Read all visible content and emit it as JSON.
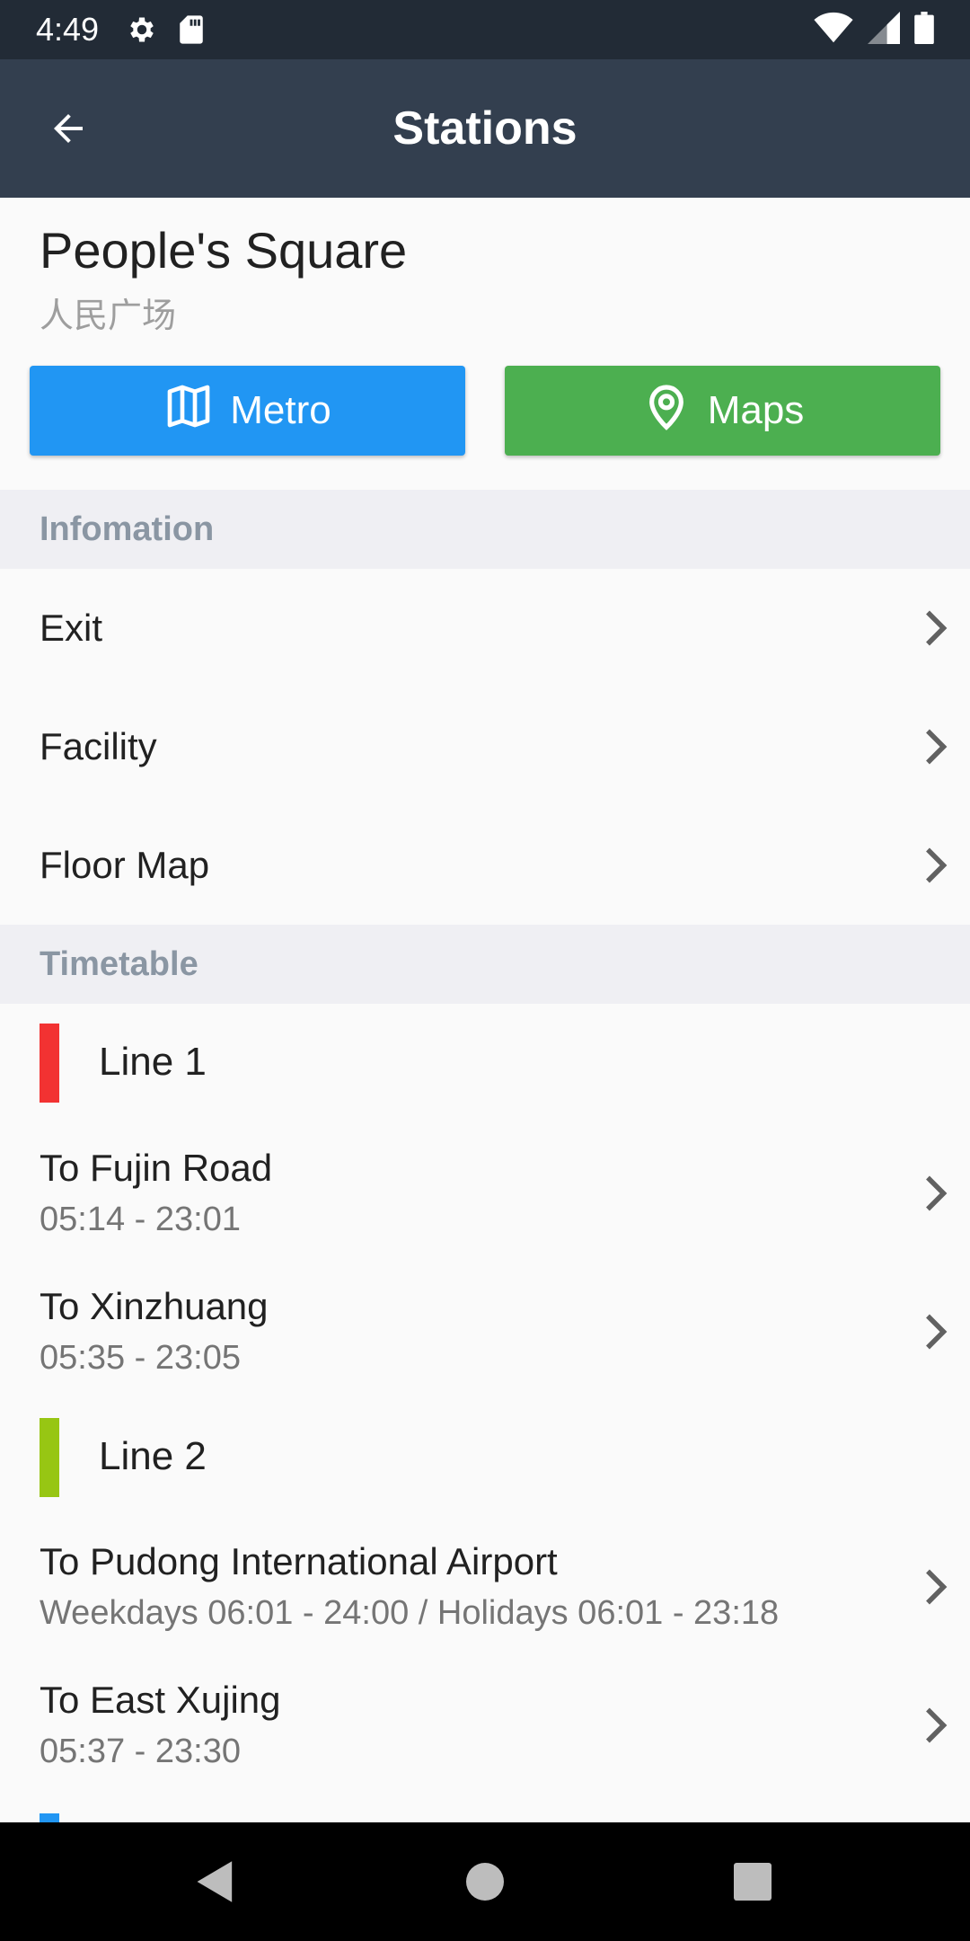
{
  "status_bar": {
    "time": "4:49",
    "icons": [
      "settings-icon",
      "sd-card-icon",
      "wifi-icon",
      "signal-icon",
      "battery-icon"
    ]
  },
  "app_bar": {
    "title": "Stations",
    "back_icon": "arrow-back-icon"
  },
  "station": {
    "name": "People's Square",
    "name_zh": "人民广场"
  },
  "actions": {
    "metro_label": "Metro",
    "maps_label": "Maps",
    "metro_color": "#2196f3",
    "maps_color": "#4caf50"
  },
  "information": {
    "header": "Infomation",
    "items": [
      {
        "label": "Exit"
      },
      {
        "label": "Facility"
      },
      {
        "label": "Floor Map"
      }
    ]
  },
  "timetable": {
    "header": "Timetable",
    "lines": [
      {
        "name": "Line 1",
        "color": "#f23232",
        "directions": [
          {
            "to": "To Fujin Road",
            "hours": "05:14 - 23:01"
          },
          {
            "to": "To Xinzhuang",
            "hours": "05:35 - 23:05"
          }
        ]
      },
      {
        "name": "Line 2",
        "color": "#97c613",
        "directions": [
          {
            "to": "To Pudong International Airport",
            "hours": "Weekdays 06:01 - 24:00 / Holidays 06:01 - 23:18"
          },
          {
            "to": "To East Xujing",
            "hours": "05:37 - 23:30"
          }
        ]
      },
      {
        "color": "#2196f3"
      }
    ]
  },
  "nav_bar": {
    "icons": [
      "back-triangle-icon",
      "home-circle-icon",
      "recents-square-icon"
    ]
  }
}
